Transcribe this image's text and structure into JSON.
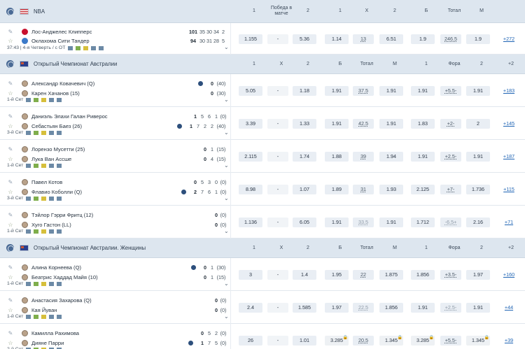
{
  "sections": [
    {
      "league": "NBA",
      "flag": "us",
      "columns": [
        "1",
        "Победа в матче",
        "2",
        "1",
        "Х",
        "2",
        "Б",
        "Тотал",
        "М"
      ],
      "more": "",
      "events": [
        {
          "players": [
            {
              "name": "Лос-Анджелес Клипперс",
              "scores": [
                "101",
                "35",
                "30",
                "34",
                "2"
              ],
              "serve": false
            },
            {
              "name": "Оклахома Сити Тандер",
              "scores": [
                "94",
                "30",
                "31",
                "28",
                "5"
              ],
              "serve": false
            }
          ],
          "info": "37:43 | 4-я Четверть / с ОТ",
          "odds": [
            "1.155",
            "-",
            "5.36",
            "1.14",
            "13",
            "6.51",
            "1.9",
            "246.5",
            "1.9"
          ],
          "more": "+272"
        }
      ]
    },
    {
      "league": "Открытый Чемпионат Австралии",
      "flag": "au",
      "columns": [
        "1",
        "Х",
        "2",
        "Б",
        "Тотал",
        "М",
        "1",
        "Фора",
        "2"
      ],
      "more": "+2",
      "events": [
        {
          "players": [
            {
              "name": "Александр Ковачевич (Q)",
              "scores": [
                "0",
                "(40)"
              ],
              "serve": true
            },
            {
              "name": "Карен Хачанов (15)",
              "scores": [
                "0",
                "(30)"
              ],
              "serve": false
            }
          ],
          "info": "1-й Сет",
          "odds": [
            "5.05",
            "-",
            "1.18",
            "1.91",
            "37.5",
            "1.91",
            "1.91",
            "+5.5-",
            "1.91"
          ],
          "more": "+183"
        },
        {
          "players": [
            {
              "name": "Даниэль Элахи Галан Риверос",
              "scores": [
                "1",
                "5",
                "6",
                "1",
                "(0)"
              ],
              "serve": false
            },
            {
              "name": "Себастьян Баез (26)",
              "scores": [
                "1",
                "7",
                "2",
                "2",
                "(40)"
              ],
              "serve": true
            }
          ],
          "info": "3-й Сет",
          "odds": [
            "3.39",
            "-",
            "1.33",
            "1.91",
            "42.5",
            "1.91",
            "1.83",
            "+2-",
            "2"
          ],
          "more": "+145"
        },
        {
          "players": [
            {
              "name": "Лорензо Мусетти (25)",
              "scores": [
                "0",
                "1",
                "(15)"
              ],
              "serve": false
            },
            {
              "name": "Лука Ван Ассше",
              "scores": [
                "0",
                "4",
                "(15)"
              ],
              "serve": false
            }
          ],
          "info": "1-й Сет",
          "odds": [
            "2.115",
            "-",
            "1.74",
            "1.88",
            "39",
            "1.94",
            "1.91",
            "+2.5-",
            "1.91"
          ],
          "more": "+187"
        },
        {
          "players": [
            {
              "name": "Павел Котов",
              "scores": [
                "0",
                "5",
                "3",
                "0",
                "(0)"
              ],
              "serve": false
            },
            {
              "name": "Флавио Коболли (Q)",
              "scores": [
                "2",
                "7",
                "6",
                "1",
                "(0)"
              ],
              "serve": true
            }
          ],
          "info": "3-й Сет",
          "odds": [
            "8.98",
            "-",
            "1.07",
            "1.89",
            "31",
            "1.93",
            "2.125",
            "+7-",
            "1.736"
          ],
          "more": "+115"
        },
        {
          "players": [
            {
              "name": "Тэйлор Гэрри Фритц (12)",
              "scores": [
                "0",
                "(0)"
              ],
              "serve": false
            },
            {
              "name": "Хуго Гастон (LL)",
              "scores": [
                "0",
                "(0)"
              ],
              "serve": false
            }
          ],
          "info": "1-й Сет",
          "odds": [
            "1.136",
            "-",
            "6.05",
            "1.91",
            "33.5",
            "1.91",
            "1.712",
            "-6.5+",
            "2.16"
          ],
          "more": "+71"
        }
      ]
    },
    {
      "league": "Открытый Чемпионат Австралии. Женщины",
      "flag": "au",
      "columns": [
        "1",
        "Х",
        "2",
        "Б",
        "Тотал",
        "М",
        "1",
        "Фора",
        "2"
      ],
      "more": "+2",
      "events": [
        {
          "players": [
            {
              "name": "Алина Корнеева (Q)",
              "scores": [
                "0",
                "1",
                "(30)"
              ],
              "serve": true
            },
            {
              "name": "Беатрис Хаддад Майя (10)",
              "scores": [
                "0",
                "1",
                "(15)"
              ],
              "serve": false
            }
          ],
          "info": "1-й Сет",
          "odds": [
            "3",
            "-",
            "1.4",
            "1.95",
            "22",
            "1.875",
            "1.856",
            "+3.5-",
            "1.97"
          ],
          "more": "+160"
        },
        {
          "players": [
            {
              "name": "Анастасия Захарова (Q)",
              "scores": [
                "0",
                "(0)"
              ],
              "serve": false
            },
            {
              "name": "Кая Йуван",
              "scores": [
                "0",
                "(0)"
              ],
              "serve": false
            }
          ],
          "info": "1-й Сет",
          "odds": [
            "2.4",
            "-",
            "1.585",
            "1.97",
            "22.5",
            "1.856",
            "1.91",
            "+2.5-",
            "1.91"
          ],
          "more": "+44"
        },
        {
          "players": [
            {
              "name": "Камилла Рахимова",
              "scores": [
                "0",
                "5",
                "2",
                "(0)"
              ],
              "serve": false
            },
            {
              "name": "Дияне Парри",
              "scores": [
                "1",
                "7",
                "5",
                "(0)"
              ],
              "serve": true
            }
          ],
          "info": "2-й Сет",
          "odds": [
            "26",
            "-",
            "1.01",
            "3.285",
            "20.5",
            "1.345",
            "3.285",
            "+5.5-",
            "1.345"
          ],
          "more": "+39"
        }
      ]
    }
  ],
  "colors": {
    "header": "#dde6ef",
    "odd": "#e9eef4",
    "link": "#1f64b4"
  }
}
